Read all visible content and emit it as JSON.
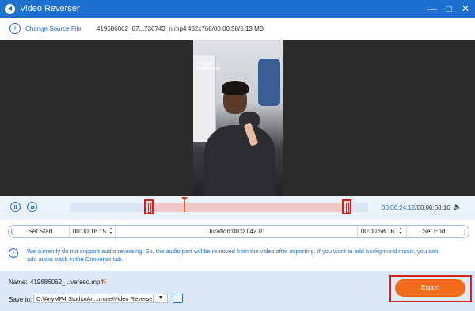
{
  "window": {
    "title": "Video Reverser"
  },
  "source": {
    "change_label": "Change Source File",
    "file_name": "419686062_67...736743_n.mp4",
    "file_info": "432x768/00:00:58/6.13 MB"
  },
  "video": {
    "overlay_text": "Snapchat\n@barbershop"
  },
  "player": {
    "current_time": "00:00:24.12",
    "total_time": "/00:00:58.16"
  },
  "trim": {
    "set_start_label": "Set Start",
    "start_time": "00:00:16.15",
    "duration_label": "Duration:00:00:42.01",
    "end_time": "00:00:58.16",
    "set_end_label": "Set End"
  },
  "notice": "We currently do not support audio reversing. So, the audio part will be removed from the video after exporting. If you want to add background music, you can add audio track in the Converter tab.",
  "output": {
    "name_label": "Name:",
    "name_value": "419686062_...versed.mp4",
    "save_label": "Save to:",
    "save_path": "C:\\AnyMP4 Studio\\An...mate\\Video Reverser",
    "export_label": "Export"
  },
  "icons": [
    "app-logo-icon",
    "minimize-icon",
    "maximize-icon",
    "close-icon",
    "plus-circle-icon",
    "pause-icon",
    "stop-icon",
    "volume-icon",
    "info-icon",
    "pencil-icon",
    "folder-icon",
    "chevron-down-icon"
  ]
}
